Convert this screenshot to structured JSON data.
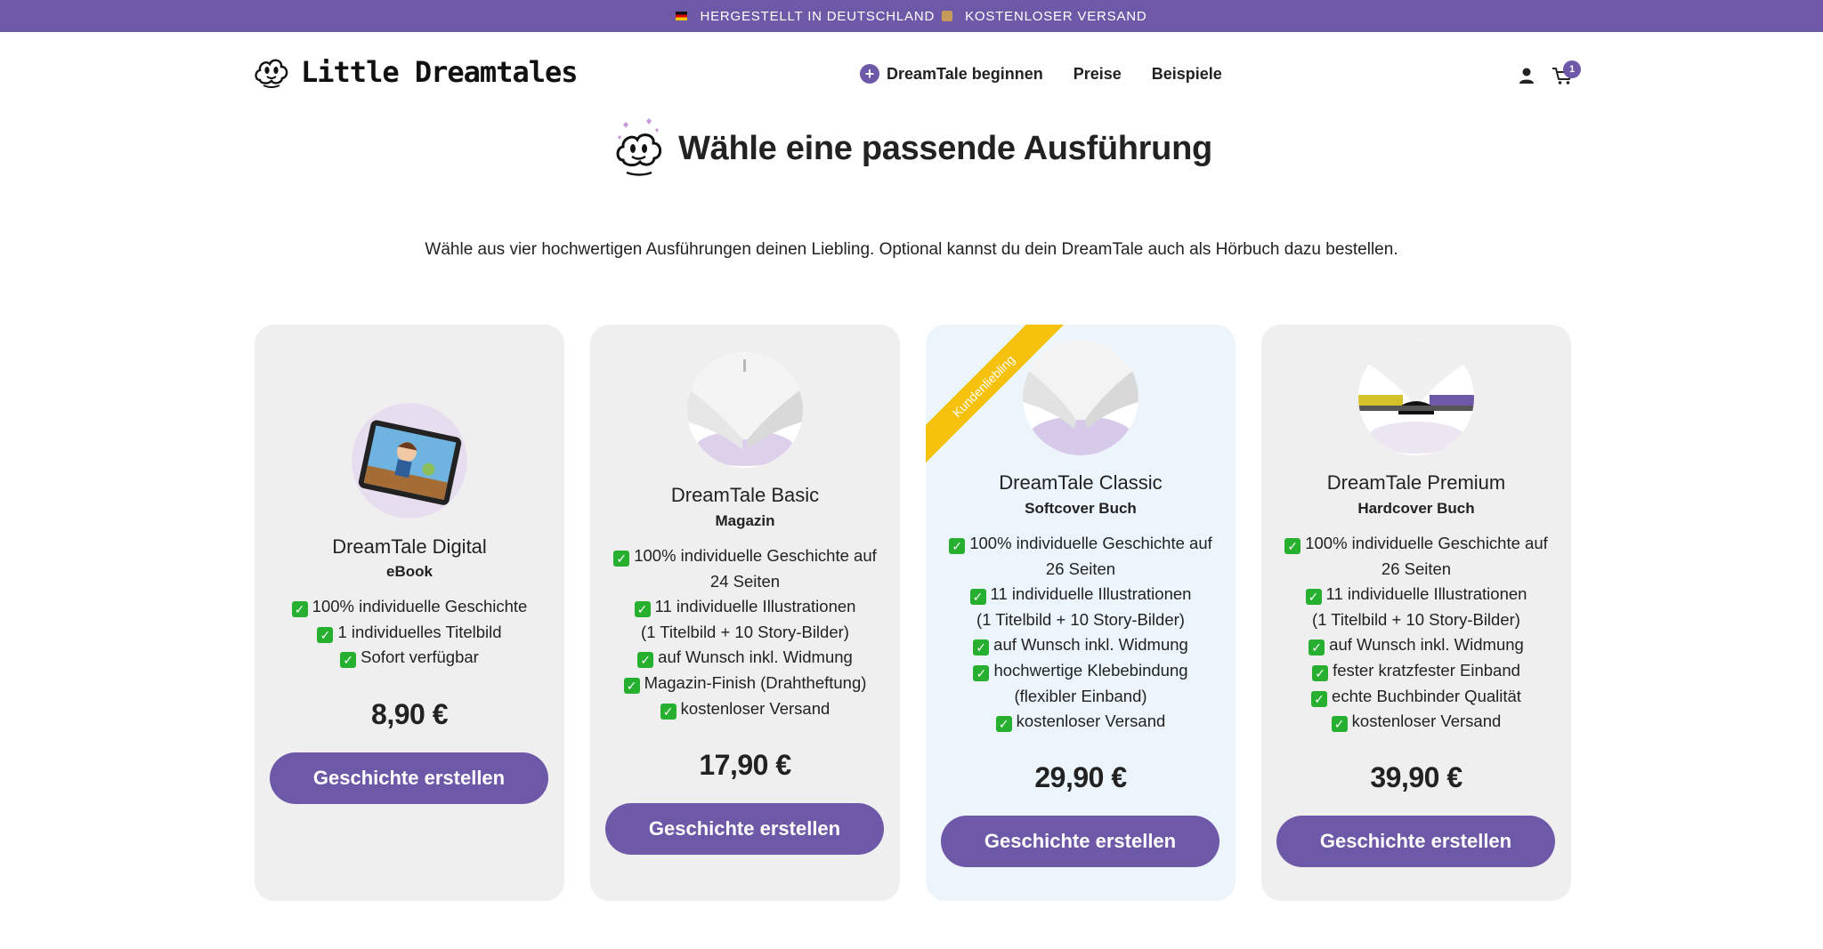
{
  "topbar": {
    "made_in": "HERGESTELLT IN DEUTSCHLAND",
    "shipping": "KOSTENLOSER VERSAND"
  },
  "header": {
    "logo": "Little Dreamtales",
    "nav": [
      "DreamTale beginnen",
      "Preise",
      "Beispiele"
    ],
    "cart_count": "1"
  },
  "page": {
    "title": "Wähle eine passende Ausführung",
    "subtitle": "Wähle aus vier hochwertigen Ausführungen deinen Liebling. Optional kannst du dein DreamTale auch als Hörbuch dazu bestellen."
  },
  "cards": [
    {
      "name": "DreamTale Digital",
      "format": "eBook",
      "features": [
        "100% individuelle Geschichte",
        "1 individuelles Titelbild",
        "Sofort verfügbar"
      ],
      "price": "8,90 €",
      "button": "Geschichte erstellen"
    },
    {
      "name": "DreamTale Basic",
      "format": "Magazin",
      "features": [
        "100% individuelle Geschichte auf",
        "24 Seiten",
        "11 individuelle Illustrationen",
        "(1 Titelbild + 10 Story-Bilder)",
        "auf Wunsch inkl. Widmung",
        "Magazin-Finish (Drahtheftung)",
        "kostenloser Versand"
      ],
      "price": "17,90 €",
      "button": "Geschichte erstellen"
    },
    {
      "name": "DreamTale Classic",
      "format": "Softcover Buch",
      "ribbon": "Kundenliebling",
      "features": [
        "100% individuelle Geschichte auf",
        "26 Seiten",
        "11 individuelle Illustrationen",
        "(1 Titelbild + 10 Story-Bilder)",
        "auf Wunsch inkl. Widmung",
        "hochwertige Klebebindung",
        "(flexibler Einband)",
        "kostenloser Versand"
      ],
      "price": "29,90 €",
      "button": "Geschichte erstellen"
    },
    {
      "name": "DreamTale Premium",
      "format": "Hardcover Buch",
      "features": [
        "100% individuelle Geschichte auf",
        "26 Seiten",
        "11 individuelle Illustrationen",
        "(1 Titelbild + 10 Story-Bilder)",
        "auf Wunsch inkl. Widmung",
        "fester kratzfester Einband",
        "echte Buchbinder Qualität",
        "kostenloser Versand"
      ],
      "price": "39,90 €",
      "button": "Geschichte erstellen"
    }
  ],
  "colors": {
    "brand": "#6e58a8",
    "ribbon": "#f5c10a",
    "check": "#27b02f",
    "card_bg": "#efefef",
    "card_highlight_bg": "#edf5fc"
  },
  "icons": {
    "logo": "cloud-face-icon",
    "user": "user-icon",
    "cart": "cart-icon",
    "nav_plus": "plus-circle-icon",
    "feature_check": "check-icon"
  }
}
